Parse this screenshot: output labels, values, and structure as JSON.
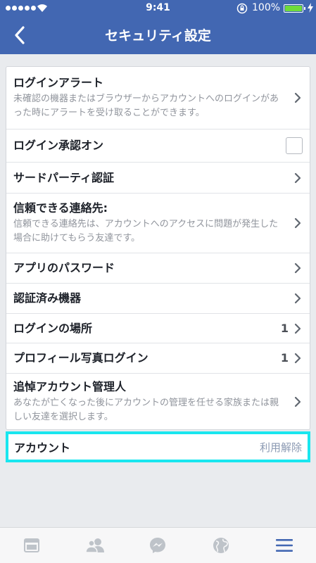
{
  "status_bar": {
    "time": "9:41",
    "battery": "100%"
  },
  "header": {
    "title": "セキュリティ設定"
  },
  "settings": [
    {
      "label": "ログインアラート",
      "desc": "未確認の機器またはブラウザーからアカウントへのログインがあった時にアラートを受け取ることができます。"
    },
    {
      "label": "ログイン承認オン"
    },
    {
      "label": "サードパーティ認証"
    },
    {
      "label": "信頼できる連絡先:",
      "desc": "信頼できる連絡先は、アカウントへのアクセスに問題が発生した場合に助けてもらう友達です。"
    },
    {
      "label": "アプリのパスワード"
    },
    {
      "label": "認証済み機器"
    },
    {
      "label": "ログインの場所",
      "count": "1"
    },
    {
      "label": "プロフィール写真ログイン",
      "count": "1"
    },
    {
      "label": "追悼アカウント管理人",
      "desc": "あなたが亡くなった後にアカウントの管理を任せる家族または親しい友達を選択します。"
    }
  ],
  "account": {
    "label": "アカウント",
    "action": "利用解除"
  },
  "tabs": [
    "news-feed-icon",
    "friends-icon",
    "messenger-icon",
    "globe-icon",
    "menu-icon"
  ],
  "colors": {
    "header": "#4267b2",
    "highlight": "#19e6ef",
    "tab_active": "#4267b2",
    "tab_inactive": "#bec3c9"
  }
}
